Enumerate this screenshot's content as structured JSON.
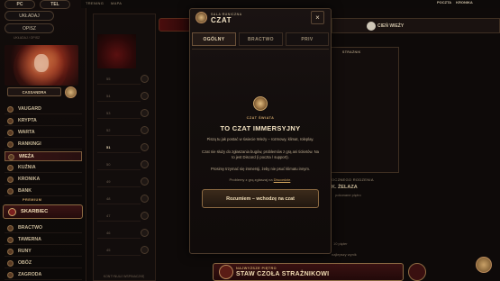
{
  "sidebar": {
    "tabs": [
      "PC",
      "TEL"
    ],
    "buttons": [
      "UKŁADAJ",
      "OPISZ"
    ],
    "small_caption": "UKŁADAJ / OPISZ",
    "character_name": "CASSANDRA",
    "nav_items": [
      {
        "label": "VAUGARD",
        "icon": "vaugard-icon"
      },
      {
        "label": "KRYPTA",
        "icon": "krypta-icon"
      },
      {
        "label": "WARTA",
        "icon": "warta-icon"
      },
      {
        "label": "RANKINGI",
        "icon": "rankingi-icon"
      },
      {
        "label": "WIEŻA",
        "icon": "wieza-icon",
        "active": true
      },
      {
        "label": "KUŹNIA",
        "icon": "kuznia-icon"
      },
      {
        "label": "KRONIKA",
        "icon": "kronika-icon"
      },
      {
        "label": "BANK",
        "icon": "bank-icon"
      }
    ],
    "premium_label": "PREMIUM",
    "skarbiec_label": "SKARBIEC",
    "bottom_items": [
      {
        "label": "BRACTWO",
        "icon": "bractwo-icon"
      },
      {
        "label": "TAWERNA",
        "icon": "tawerna-icon"
      },
      {
        "label": "RUNY",
        "icon": "runy-icon"
      },
      {
        "label": "OBÓZ",
        "icon": "oboz-icon"
      },
      {
        "label": "ZAGRODA",
        "icon": "zagroda-icon"
      }
    ]
  },
  "topbar": {
    "left_items": [
      "TRENING",
      "MAPA"
    ],
    "right_items": [
      "POCZTA",
      "KRONIKA"
    ]
  },
  "tower": {
    "floor_labels": [
      "55",
      "54",
      "53",
      "52",
      "51",
      "50",
      "49",
      "48",
      "47",
      "46",
      "45"
    ],
    "current_floor": "51",
    "shadow_tab": "CIEŃ WIEŻY",
    "guardian_tag": "STRAŻNIK",
    "right_caption": "OCZNEGO RODZENIA",
    "right_title": "K. ŻELAZA",
    "right_sub": "pokonane piętro",
    "right_footer1": "10 pięter",
    "right_footer2": "najlepszy wynik",
    "banner_label": "NAJWYŻSZE PIĘTRO",
    "banner_title": "STAW CZOŁA STRAŻNIKOWI",
    "bottom_caption": "KONTYNUUJ WSPINACZKĘ"
  },
  "modal": {
    "subtitle": "SALA RUNICZNA",
    "title": "CZAT",
    "close_glyph": "×",
    "tabs": [
      {
        "label": "OGÓLNY",
        "active": true
      },
      {
        "label": "BRACTWO",
        "active": false
      },
      {
        "label": "PRIV",
        "active": false
      }
    ],
    "content_label": "CZAT ŚWIATA",
    "content_title": "TO CZAT IMMERSYJNY",
    "paragraphs": [
      "Piszą tu jak postać w świecie Wieży – rozmowy, klimat, roleplay.",
      "Czat nie służy do zgłaszania bugów, problemów z grą ani ticketów. Na to jest Discord (i poczta / support).",
      "Prosimy trzymać się immersji, żeby nie psuć klimatu innym."
    ],
    "note_prefix": "Problemy z grą zgłaszaj na ",
    "note_link": "Discordzie",
    "note_suffix": ".",
    "accept_button": "Rozumiem – wchodzę na czat"
  }
}
